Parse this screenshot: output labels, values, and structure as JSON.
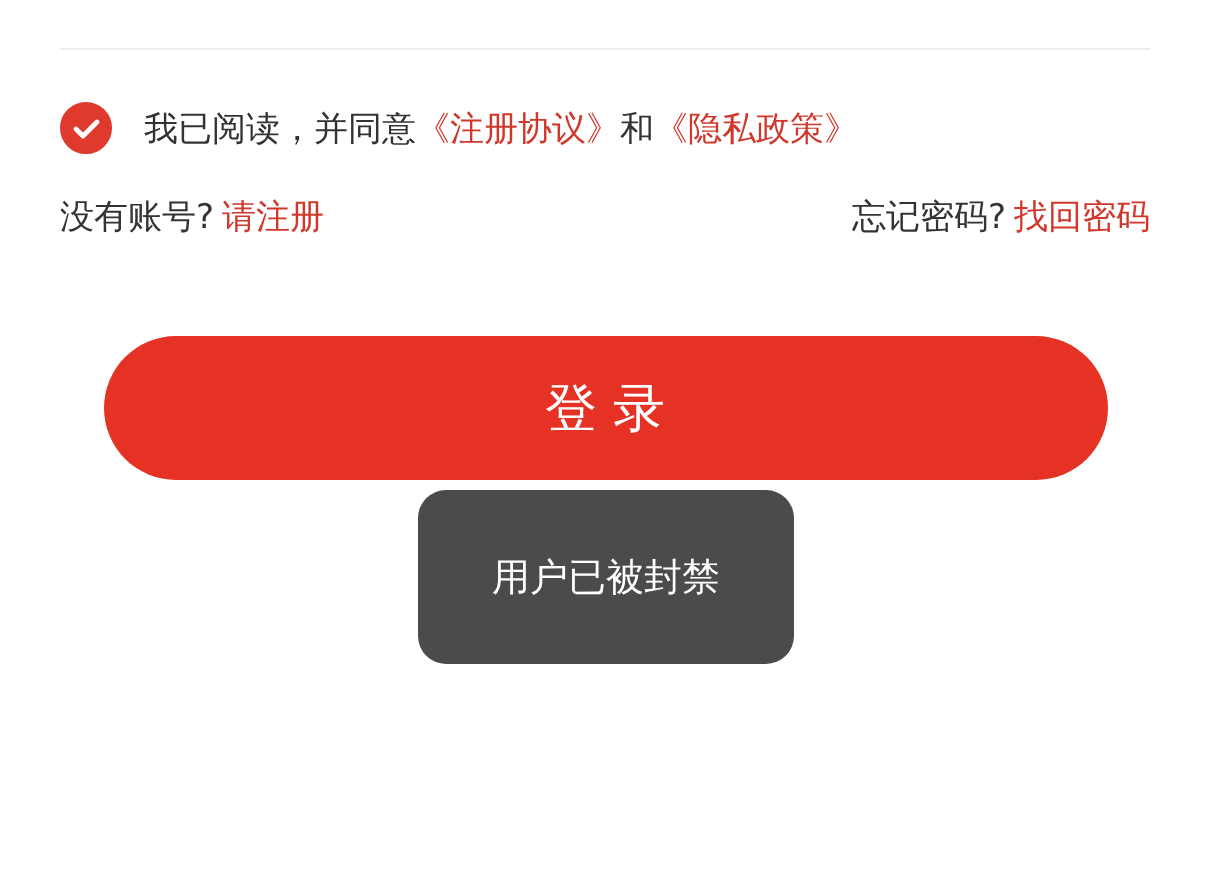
{
  "agreement": {
    "checked": true,
    "parts": [
      {
        "kind": "text",
        "text": "我已阅读，并同意"
      },
      {
        "kind": "link",
        "text": "《注册协议》"
      },
      {
        "kind": "text",
        "text": "和"
      },
      {
        "kind": "link",
        "text": "《隐私政策》"
      }
    ]
  },
  "register": {
    "prompt": "没有账号?",
    "link": "请注册"
  },
  "recover": {
    "prompt": "忘记密码?",
    "link": "找回密码"
  },
  "login_button": "登 录",
  "toast": "用户已被封禁"
}
